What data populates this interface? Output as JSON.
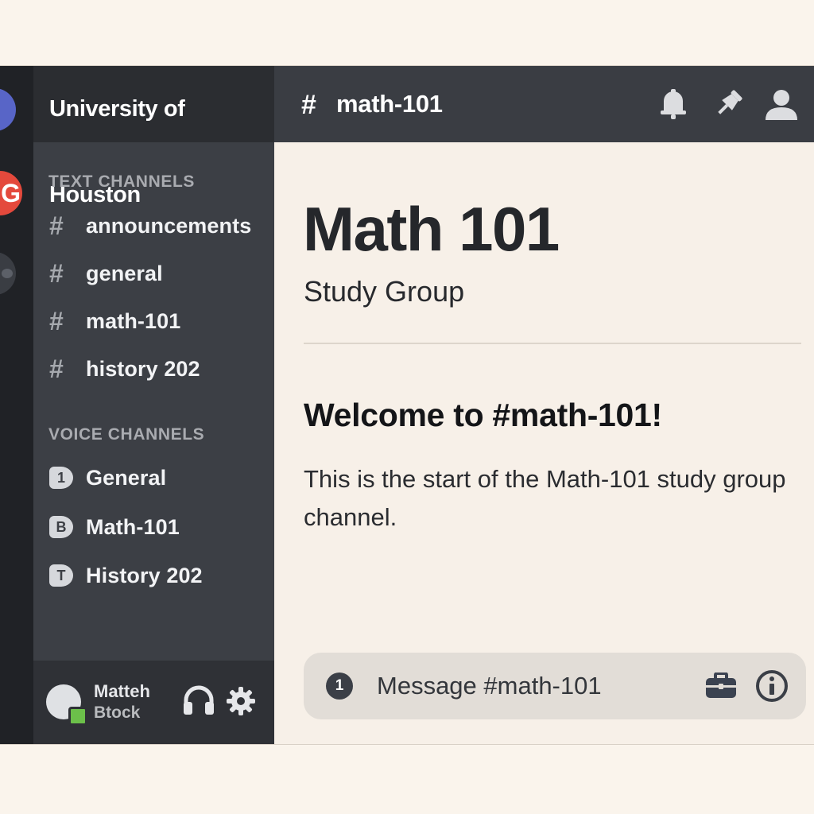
{
  "servers": [
    {
      "name": "server-1",
      "color": "#5865c7"
    },
    {
      "name": "server-2",
      "color": "#e4493c",
      "glyph": "G"
    },
    {
      "name": "server-3",
      "color": "#3a3d43"
    }
  ],
  "sidebar": {
    "server_name": "University of Houston",
    "text_category": "TEXT CHANNELS",
    "text_channels": [
      "announcements",
      "general",
      "math-101",
      "history 202"
    ],
    "voice_category": "VOICE CHANNELS",
    "voice_channels": [
      {
        "label": "General",
        "glyph": "1"
      },
      {
        "label": "Math-101",
        "glyph": "B"
      },
      {
        "label": "History 202",
        "glyph": "T"
      }
    ],
    "user": {
      "name_line1": "Matteh",
      "name_line2": "Btock",
      "status_color": "#6cc04a"
    }
  },
  "header": {
    "channel_hash": "#",
    "channel_name": "math-101",
    "icons": [
      "bell-icon",
      "pin-icon",
      "member-list-icon"
    ]
  },
  "main": {
    "title": "Math 101",
    "subtitle": "Study Group",
    "welcome": "Welcome to #math-101!",
    "description": "This is the start of the Math-101 study group channel."
  },
  "composer": {
    "plus_glyph": "1",
    "placeholder": "Message #math-101",
    "icons": [
      "briefcase-icon",
      "info-icon"
    ]
  },
  "colors": {
    "sidebar_bg": "#3c3f45",
    "header_bg": "#2b2d31",
    "main_bg": "#f7f0e8"
  }
}
